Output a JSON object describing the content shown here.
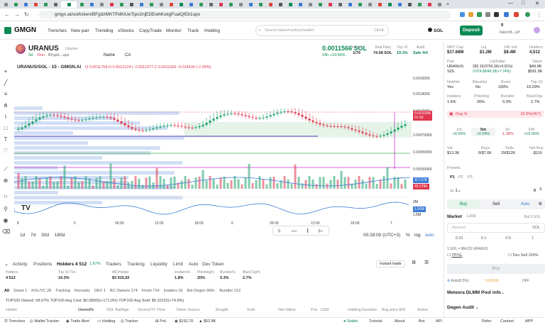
{
  "browser": {
    "url": "gmgn.ai/sol/token/BFgdzMKTPdKiUeTipv2njEDEwhKxkgFuaIQfGt1ups",
    "tab_title": "G",
    "window_controls": [
      "—",
      "□",
      "✕"
    ]
  },
  "nav": {
    "logo": "GMGN",
    "items": [
      "Trenches",
      "New pair",
      "Trending",
      "xStocks",
      "CopyTrade",
      "Monitor",
      "Track",
      "Holding"
    ],
    "search_placeholder": "Search token/contract/wallet",
    "search_shortcut": "Ctrl+K",
    "chain": "SOL",
    "deposit": "Deposit",
    "balance": "0",
    "account": "fakcm8...pP"
  },
  "token": {
    "name": "URANUS",
    "subtitle": "Uranus",
    "age": "3d",
    "run": "Run",
    "address": "BFgdz...ups",
    "name_label": "Name",
    "ca_label": "CA",
    "price": "0.0011566 SOL",
    "change": "24h +19.96%",
    "snipers": "Snipers",
    "snipers_v": "1/70",
    "total_fees": "Total Fees",
    "total_fees_v": "74.58 SOL",
    "top10": "Top 10",
    "top10_v": "19.3%",
    "audit": "Audit",
    "audit_v": "Safe 4/4"
  },
  "chart": {
    "title": "URANUS/SOL - 15 - GMGN.AI",
    "ohlc": "O 0.0011759 H 0.0012124 L 0.0011377 C 0.0011566 -0.024634 (-2.09%)",
    "y_labels": [
      "0.0016000",
      "0.0014000",
      "0.0012000",
      "0.0011566",
      "0.00099999",
      "0.00079999",
      "0.00059999",
      "0.00039999",
      "0.00019999"
    ],
    "x_labels": [
      "8",
      "5",
      "06:00",
      "12:00",
      "18:00",
      "6",
      "06:00",
      "12:00",
      "18:00",
      "7"
    ],
    "vol_label": "117.07K",
    "vol_label2": "45.279K",
    "ind_label": "2M",
    "ind_label2": "1.55M",
    "ind_label3": "1.5M",
    "time": "00:28:00 (UTC+3)",
    "price_tag": "0.0011566",
    "price_tag2": "01:59",
    "ranges": [
      "1d",
      "7d",
      "30d",
      "180d"
    ],
    "log": "log",
    "auto": "auto",
    "pct": "%"
  },
  "bottom": {
    "tabs": [
      "Activity",
      "Positions",
      "Holders 4 512",
      "Traders",
      "Tracking",
      "Liquidity",
      "Limit",
      "Auto",
      "Dev Token"
    ],
    "holder_pct": "1.67%",
    "instant_trade": "Instant trade",
    "stats": [
      {
        "l": "Holders",
        "v": "4 512"
      },
      {
        "l": "Top 10 Tkn",
        "v": "19.3%"
      },
      {
        "l": "MC/Holder",
        "v": "$3 915,92"
      },
      {
        "l": "Insiders%",
        "v": "1.8%"
      },
      {
        "l": "Phishing%",
        "v": "20%"
      },
      {
        "l": "Bundler%",
        "v": "0.3%"
      },
      {
        "l": "BlueChip%",
        "v": "2.7%"
      }
    ],
    "filters": [
      "All",
      "Smart 1",
      "KOL/VC 28",
      "Tracking",
      "Remarks",
      "DEV 1",
      "BC Owners 174",
      "Fresh 714",
      "Insiders 16",
      "Bot Degen 999+",
      "Bundler 212"
    ],
    "summary": "TOP100 Owned: 68.07%  TOP100 Avg Cost: $0.08505(+171.0%)  TOP100 Avg Sold: $0.10102(+74.9%)",
    "cols": [
      "Holder",
      "Owned%",
      "SOL Bal/Age",
      "Source/TF Time",
      "Token Source",
      "Bought",
      "Sold",
      "Net Inflow",
      "PnL",
      "USD",
      "Holding Duration",
      "Avg price B/S",
      "Active"
    ]
  },
  "panel": {
    "mc": "MKT Cap",
    "mc_v": "$17.68M",
    "liq": "Liq",
    "liq_v": "$1.2M",
    "vol": "24h Vol",
    "vol_v": "$8.4M",
    "hold": "Holders",
    "hold_v": "4,512",
    "pair": "Pair",
    "pair_v": "URANUS",
    "sol": "SOL",
    "liq_init": "Liq/Initial",
    "liq_init_v": "282.1K/3706.3K(+0.01%)",
    "liq_init_v2": "3 874.89/49.28(+7.74%)",
    "value": "Value",
    "value_v": "$49.8K",
    "value_v2": "$591.9K",
    "checks": [
      {
        "l": "NoMint",
        "v": "Yes"
      },
      {
        "l": "Blacklist",
        "v": "No"
      },
      {
        "l": "Burnt",
        "v": "100%"
      },
      {
        "l": "Top 10",
        "v": "19.29%"
      }
    ],
    "checks2": [
      {
        "l": "Insiders",
        "v": "1.6%"
      },
      {
        "l": "Phishing",
        "v": "20%"
      },
      {
        "l": "Bundler",
        "v": "0.3%"
      },
      {
        "l": "BlueChip",
        "v": "2.7%"
      }
    ],
    "rug": "Rug %",
    "rug_v": "22.9%(457)",
    "tf": [
      {
        "l": "1m",
        "v": "+0.06%"
      },
      {
        "l": "5m",
        "v": "+0.04%"
      },
      {
        "l": "1h",
        "v": "-1.38%"
      },
      {
        "l": "24h",
        "v": "+19.96%"
      }
    ],
    "vol5": "Vol",
    "vol5_v": "$13.3K",
    "buys": "Buys",
    "buys_v": "9/$7.6K",
    "sells": "Sells",
    "sells_v": "29/$12K",
    "netbuy": "Net Buy",
    "netbuy_v": "-$116",
    "presets": "Presets",
    "p": [
      "P1",
      "P2",
      "P3"
    ],
    "buy": "Buy",
    "sell": "Sell",
    "auto": "Auto",
    "market": "Market",
    "limit": "Limit",
    "bal": "Bal 0 SOL",
    "amount": "Amount",
    "amounts": [
      "0.01",
      "0.1",
      "0.5",
      "1"
    ],
    "rate": "1 SOL = 864,55 URANUS",
    "tpsl": "TP/SL",
    "devsell": "Dev Sell 100%",
    "buybtn": "Buy",
    "auto_pct": "Auto(0.5%)",
    "fee": "0.003(4)",
    "off": "OFF",
    "pool": "Meteora DLMM Pool info",
    "degen": "Degen Audit"
  },
  "status": {
    "items": [
      "Trenches",
      "Wallet Tracker",
      "Trade Alert",
      "Holding",
      "Tracker",
      "PnL",
      "$152,70",
      "$62.8K",
      "Stable",
      "Tutorial",
      "About",
      "Bot",
      "API",
      "Refer",
      "Contest",
      "APP"
    ]
  }
}
